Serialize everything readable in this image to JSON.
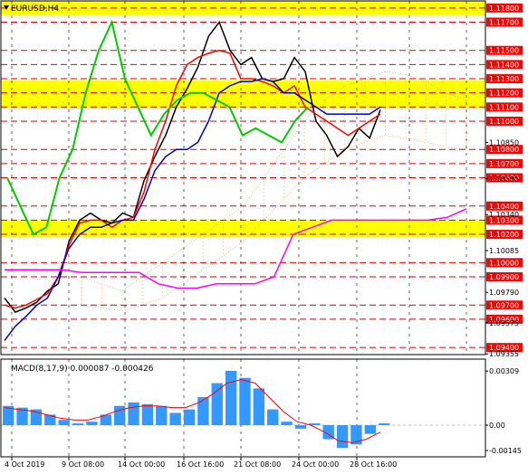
{
  "chart_data": [
    {
      "type": "line",
      "title": "EURUSD,H4",
      "x_labels": [
        "4 Oct 2019",
        "9 Oct 08:00",
        "14 Oct 00:00",
        "16 Oct 16:00",
        "21 Oct 08:00",
        "24 Oct 00:00",
        "28 Oct 16:00"
      ],
      "ylim": [
        1.09355,
        1.1085
      ],
      "grid": true,
      "price_levels": [
        "1.11800",
        "1.11700",
        "1.11500",
        "1.11400",
        "1.11300",
        "1.11200",
        "1.11100",
        "1.11000",
        "1.10800",
        "1.10700",
        "1.10600",
        "1.10400",
        "1.10300",
        "1.10200",
        "1.10000",
        "1.09900",
        "1.09700",
        "1.09600",
        "1.09400"
      ],
      "plain_ticks": [
        "1.10850",
        "1.10595",
        "1.10340",
        "1.10085",
        "1.09790",
        "1.09575",
        "1.09355"
      ],
      "yellow_zones": [
        [
          1.1175,
          1.1185
        ],
        [
          1.1109,
          1.1129
        ],
        [
          1.1018,
          1.103
        ]
      ],
      "series": [
        {
          "values": [
            1.0975,
            1.0965,
            1.0968,
            1.0972,
            1.098,
            1.0985,
            1.1015,
            1.103,
            1.1035,
            1.103,
            1.1028,
            1.1035,
            1.1032,
            1.1058,
            1.1075,
            1.109,
            1.111,
            1.1123,
            1.1138,
            1.116,
            1.117,
            1.115,
            1.114,
            1.1145,
            1.113,
            1.1128,
            1.113,
            1.1145,
            1.1135,
            1.11,
            1.109,
            1.1075,
            1.1082,
            1.1095,
            1.1088,
            1.1108
          ],
          "color": "#000000"
        },
        {
          "values": [
            1.097,
            1.0968,
            1.097,
            1.0974,
            1.0978,
            1.099,
            1.1012,
            1.1028,
            1.103,
            1.103,
            1.1025,
            1.103,
            1.1032,
            1.105,
            1.108,
            1.11,
            1.1125,
            1.114,
            1.1145,
            1.1148,
            1.115,
            1.1148,
            1.113,
            1.113,
            1.1128,
            1.1125,
            1.112,
            1.1125,
            1.111,
            1.1105,
            1.11,
            1.1095,
            1.109,
            1.1095,
            1.11,
            1.1105
          ],
          "color": "#ff0000"
        },
        {
          "values": [
            1.0945,
            1.0955,
            1.0962,
            1.097,
            1.0975,
            1.099,
            1.101,
            1.102,
            1.1025,
            1.1025,
            1.1028,
            1.103,
            1.103,
            1.1045,
            1.1065,
            1.1075,
            1.108,
            1.108,
            1.1085,
            1.11,
            1.112,
            1.1125,
            1.1128,
            1.1128,
            1.113,
            1.1128,
            1.112,
            1.112,
            1.1115,
            1.111,
            1.1105,
            1.1105,
            1.1105,
            1.1105,
            1.1105,
            1.111
          ],
          "color": "#0000cd"
        },
        {
          "values": [
            1.106,
            1.104,
            1.102,
            1.1025,
            1.106,
            1.108,
            1.112,
            1.115,
            1.117,
            1.113,
            1.111,
            1.109,
            1.1105,
            1.1115,
            1.112,
            1.112,
            1.1115,
            1.111,
            1.109,
            1.1095,
            1.109,
            1.1085,
            1.11,
            1.111
          ],
          "color": "#00cc00"
        },
        {
          "values": [
            1.0995,
            1.0995,
            1.0995,
            1.0995,
            1.0993,
            1.0993,
            1.0993,
            1.0993,
            1.0985,
            1.0982,
            1.0982,
            1.0985,
            1.0985,
            1.0985,
            1.099,
            1.102,
            1.1025,
            1.103,
            1.103,
            1.103,
            1.103,
            1.103,
            1.103,
            1.1032,
            1.1038
          ],
          "color": "#ff00ff"
        }
      ],
      "macd": {
        "label": "MACD(8,17,9) 0.000087 -0.000426",
        "y_ticks": [
          "0.00309",
          "0.00",
          "-0.00145"
        ],
        "histogram": [
          0.0011,
          0.001,
          0.0009,
          0.0006,
          0.0003,
          0.0001,
          0.0002,
          0.0006,
          0.0011,
          0.0013,
          0.0012,
          0.0011,
          0.0007,
          0.0009,
          0.0016,
          0.0024,
          0.0031,
          0.0027,
          0.0021,
          0.0009,
          0.0002,
          -0.0002,
          0.0001,
          -0.0008,
          -0.0013,
          -0.0011,
          -0.0005,
          0.0001
        ],
        "signal": [
          0.001,
          0.0009,
          0.0008,
          0.0006,
          0.0004,
          0.0003,
          0.0003,
          0.0005,
          0.0008,
          0.001,
          0.0011,
          0.0011,
          0.001,
          0.001,
          0.0013,
          0.0018,
          0.0024,
          0.0026,
          0.0024,
          0.0016,
          0.0008,
          0.0002,
          0.0,
          -0.0004,
          -0.0009,
          -0.001,
          -0.0008,
          -0.0004
        ]
      }
    }
  ],
  "colors": {
    "yellow": "#ffff00",
    "level_line": "#e00000",
    "price_tag": "#ff0000",
    "histogram": "#3399ff",
    "signal": "#ff0000"
  }
}
